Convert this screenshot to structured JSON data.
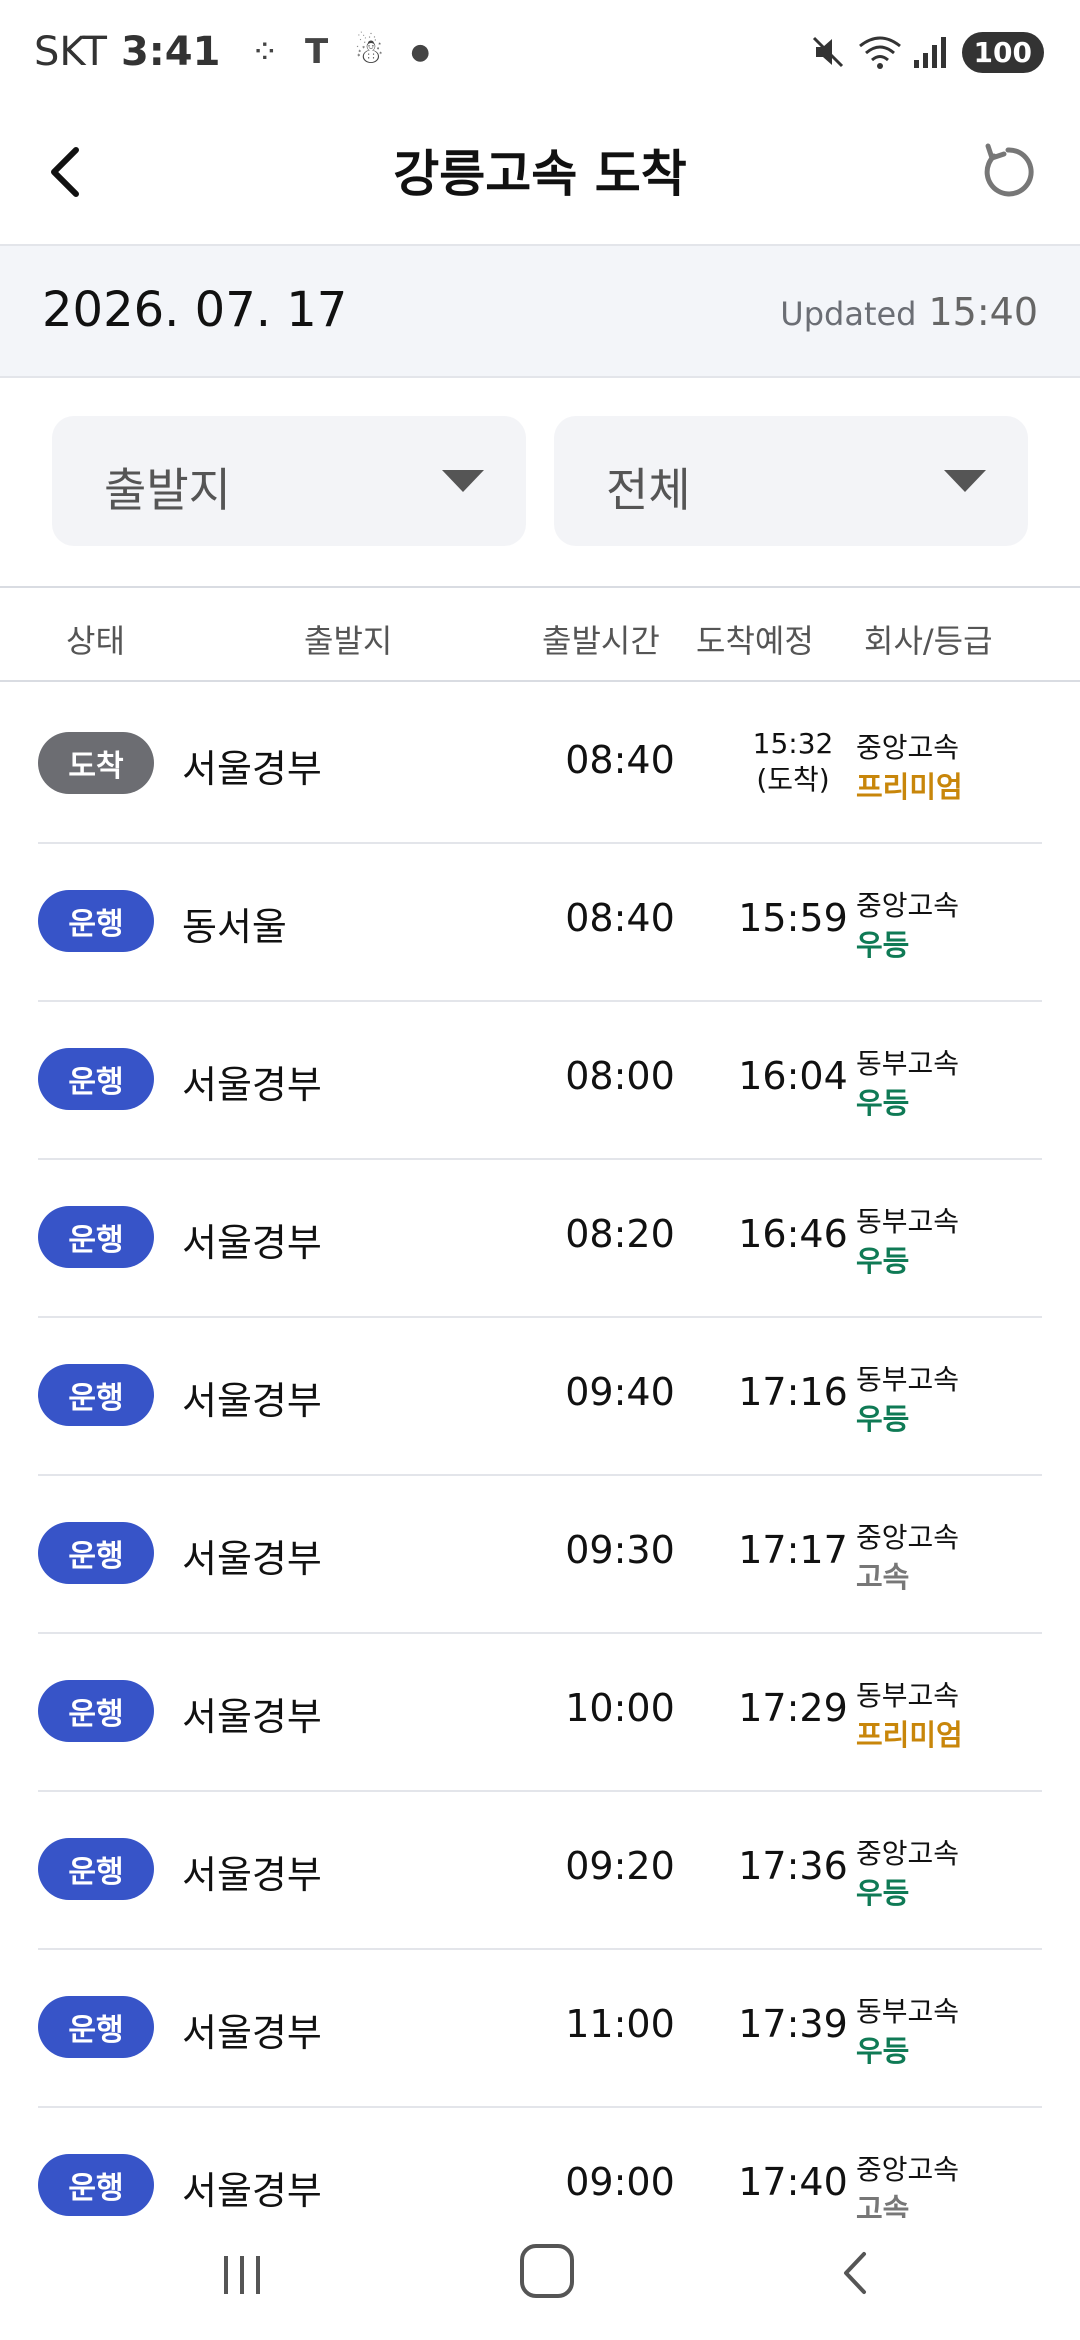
{
  "status_bar": {
    "carrier": "SKT",
    "time": "3:41",
    "battery": "100"
  },
  "header": {
    "title": "강릉고속 도착"
  },
  "datebar": {
    "date": "2026. 07. 17",
    "updated_label": "Updated",
    "updated_time": "15:40"
  },
  "filters": {
    "origin": "출발지",
    "grade": "전체"
  },
  "columns": {
    "status": "상태",
    "origin": "출발지",
    "departure": "출발시간",
    "arrival": "도착예정",
    "company": "회사/등급"
  },
  "colors": {
    "arrived_badge": "#6c6d72",
    "running_badge": "#3754c8",
    "premium": "#c8860a",
    "udeung": "#0f7a55",
    "gosok": "#777777"
  },
  "rows": [
    {
      "status": "도착",
      "status_type": "arrived",
      "origin": "서울경부",
      "departure": "08:40",
      "arrival": "15:32",
      "arrival_note": "(도착)",
      "company": "중앙고속",
      "grade": "프리미엄",
      "grade_type": "premium"
    },
    {
      "status": "운행",
      "status_type": "running",
      "origin": "동서울",
      "departure": "08:40",
      "arrival": "15:59",
      "company": "중앙고속",
      "grade": "우등",
      "grade_type": "udeung"
    },
    {
      "status": "운행",
      "status_type": "running",
      "origin": "서울경부",
      "departure": "08:00",
      "arrival": "16:04",
      "company": "동부고속",
      "grade": "우등",
      "grade_type": "udeung"
    },
    {
      "status": "운행",
      "status_type": "running",
      "origin": "서울경부",
      "departure": "08:20",
      "arrival": "16:46",
      "company": "동부고속",
      "grade": "우등",
      "grade_type": "udeung"
    },
    {
      "status": "운행",
      "status_type": "running",
      "origin": "서울경부",
      "departure": "09:40",
      "arrival": "17:16",
      "company": "동부고속",
      "grade": "우등",
      "grade_type": "udeung"
    },
    {
      "status": "운행",
      "status_type": "running",
      "origin": "서울경부",
      "departure": "09:30",
      "arrival": "17:17",
      "company": "중앙고속",
      "grade": "고속",
      "grade_type": "gosok"
    },
    {
      "status": "운행",
      "status_type": "running",
      "origin": "서울경부",
      "departure": "10:00",
      "arrival": "17:29",
      "company": "동부고속",
      "grade": "프리미엄",
      "grade_type": "premium"
    },
    {
      "status": "운행",
      "status_type": "running",
      "origin": "서울경부",
      "departure": "09:20",
      "arrival": "17:36",
      "company": "중앙고속",
      "grade": "우등",
      "grade_type": "udeung"
    },
    {
      "status": "운행",
      "status_type": "running",
      "origin": "서울경부",
      "departure": "11:00",
      "arrival": "17:39",
      "company": "동부고속",
      "grade": "우등",
      "grade_type": "udeung"
    },
    {
      "status": "운행",
      "status_type": "running",
      "origin": "서울경부",
      "departure": "09:00",
      "arrival": "17:40",
      "company": "중앙고속",
      "grade": "고속",
      "grade_type": "gosok"
    }
  ]
}
